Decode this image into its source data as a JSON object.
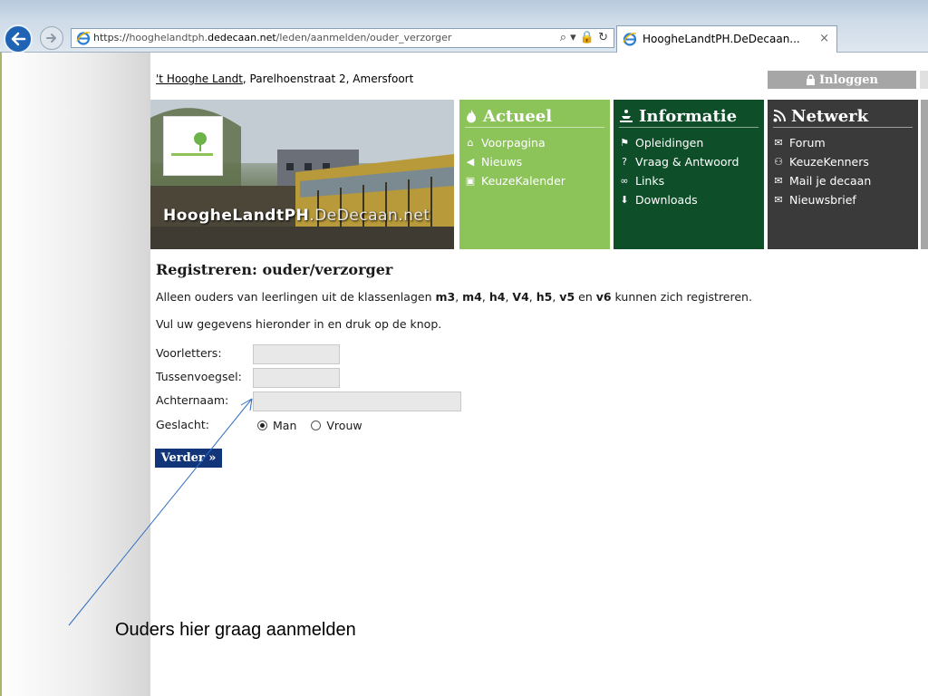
{
  "browser": {
    "url_scheme": "https://",
    "url_host_pre": "hooghelandtph.",
    "url_host": "dedecaan.net",
    "url_path": "/leden/aanmelden/ouder_verzorger",
    "address_icons": "⌕ ▾ 🔒 ↻",
    "tab_title": "HoogheLandtPH.DeDecaan...",
    "tab_close": "×"
  },
  "site": {
    "school_link": "'t Hooghe Landt",
    "school_address": ", Parelhoenstraat 2, Amersfoort",
    "login_label": "Inloggen",
    "banner_name_bold": "HoogheLandtPH",
    "banner_name_light": ".DeDecaan.net"
  },
  "menu": {
    "actueel": {
      "title": "Actueel",
      "items": [
        {
          "label": "Voorpagina",
          "icon": "home-icon"
        },
        {
          "label": "Nieuws",
          "icon": "megaphone-icon"
        },
        {
          "label": "KeuzeKalender",
          "icon": "calendar-icon"
        }
      ]
    },
    "informatie": {
      "title": "Informatie",
      "items": [
        {
          "label": "Opleidingen",
          "icon": "sign-icon"
        },
        {
          "label": "Vraag & Antwoord",
          "icon": "question-icon"
        },
        {
          "label": "Links",
          "icon": "link-icon"
        },
        {
          "label": "Downloads",
          "icon": "download-icon"
        }
      ]
    },
    "netwerk": {
      "title": "Netwerk",
      "items": [
        {
          "label": "Forum",
          "icon": "chat-icon"
        },
        {
          "label": "KeuzeKenners",
          "icon": "users-icon"
        },
        {
          "label": "Mail je decaan",
          "icon": "mail-icon"
        },
        {
          "label": "Nieuwsbrief",
          "icon": "newsletter-icon"
        }
      ]
    }
  },
  "content": {
    "heading": "Registreren: ouder/verzorger",
    "intro_pre": "Alleen ouders van leerlingen uit de klassenlagen ",
    "intro_classes": [
      "m3",
      "m4",
      "h4",
      "V4",
      "h5",
      "v5",
      "v6"
    ],
    "intro_sep_and": " en ",
    "intro_post": " kunnen zich registreren.",
    "instruction": "Vul uw gegevens hieronder in en druk op de knop.",
    "form": {
      "voorletters_label": "Voorletters:",
      "voorletters_value": "",
      "tussenvoegsel_label": "Tussenvoegsel:",
      "tussenvoegsel_value": "",
      "achternaam_label": "Achternaam:",
      "achternaam_value": "",
      "geslacht_label": "Geslacht:",
      "geslacht_options": [
        "Man",
        "Vrouw"
      ],
      "geslacht_selected": "Man",
      "submit_label": "Verder »"
    }
  },
  "annotation": {
    "text": "Ouders hier graag aanmelden",
    "color": "#2e6dbf"
  }
}
